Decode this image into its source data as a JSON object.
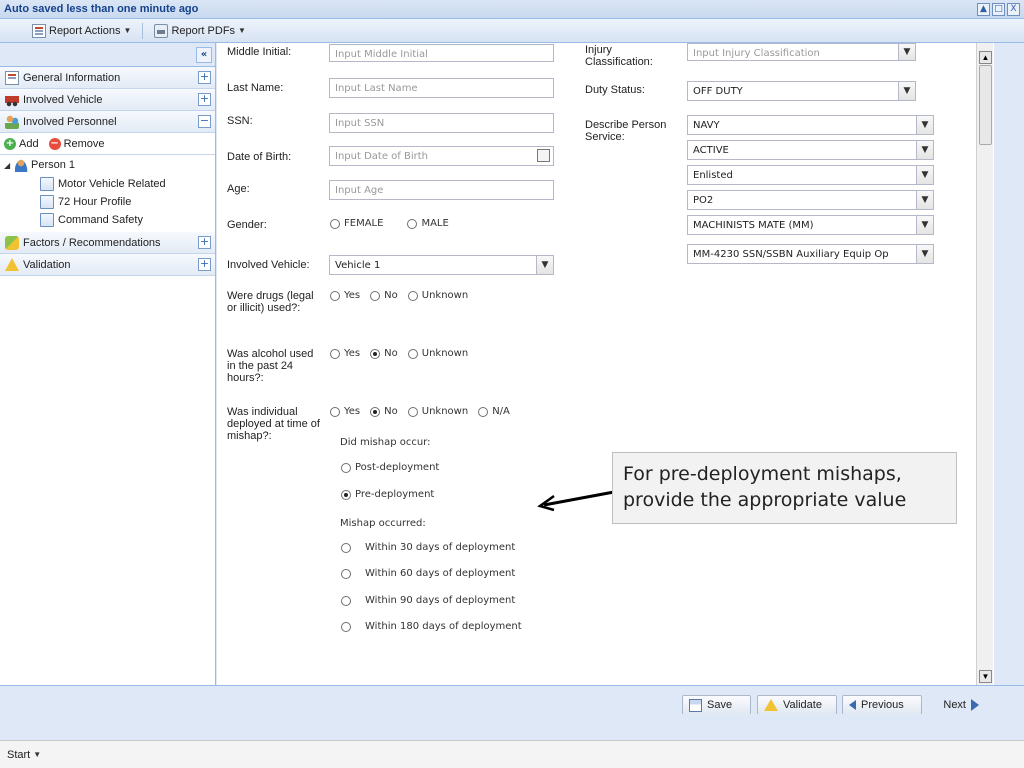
{
  "window": {
    "title": "Auto saved less than one minute ago",
    "controls": [
      "▲",
      "□",
      "X"
    ]
  },
  "toolbar": {
    "report_actions": "Report Actions",
    "report_pdfs": "Report PDFs"
  },
  "sidebar": {
    "collapse": "«",
    "items": [
      {
        "label": "General Information",
        "icon": "document-icon",
        "toggle": "+"
      },
      {
        "label": "Involved Vehicle",
        "icon": "car-icon",
        "toggle": "+"
      },
      {
        "label": "Involved Personnel",
        "icon": "people-icon",
        "toggle": "−"
      }
    ],
    "add_label": "Add",
    "remove_label": "Remove",
    "person_node": "Person 1",
    "person_children": [
      "Motor Vehicle Related",
      "72 Hour Profile",
      "Command Safety"
    ],
    "items_after": [
      {
        "label": "Factors / Recommendations",
        "icon": "puzzle-icon",
        "toggle": "+"
      },
      {
        "label": "Validation",
        "icon": "warning-icon",
        "toggle": "+"
      }
    ]
  },
  "form": {
    "middle_initial": {
      "label": "Middle Initial:",
      "placeholder": "Input Middle Initial"
    },
    "last_name": {
      "label": "Last Name:",
      "placeholder": "Input Last Name"
    },
    "ssn": {
      "label": "SSN:",
      "placeholder": "Input SSN"
    },
    "dob": {
      "label": "Date of Birth:",
      "placeholder": "Input Date of Birth"
    },
    "age": {
      "label": "Age:",
      "placeholder": "Input Age"
    },
    "gender": {
      "label": "Gender:",
      "options": [
        "FEMALE",
        "MALE"
      ]
    },
    "involved_vehicle": {
      "label": "Involved Vehicle:",
      "value": "Vehicle 1"
    },
    "drugs": {
      "label": "Were drugs (legal or illicit) used?:",
      "options": [
        "Yes",
        "No",
        "Unknown"
      ],
      "selected": null
    },
    "alcohol": {
      "label": "Was alcohol used in the past 24 hours?:",
      "options": [
        "Yes",
        "No",
        "Unknown"
      ],
      "selected": "No"
    },
    "deployed": {
      "label": "Was individual deployed at time of mishap?:",
      "options": [
        "Yes",
        "No",
        "Unknown",
        "N/A"
      ],
      "selected": "No"
    },
    "did_mishap_occur": {
      "label": "Did mishap occur:",
      "options": [
        "Post-deployment",
        "Pre-deployment"
      ],
      "selected": "Pre-deployment"
    },
    "mishap_occurred": {
      "label": "Mishap occurred:",
      "options": [
        "Within 30 days of deployment",
        "Within 60 days of deployment",
        "Within 90 days of deployment",
        "Within 180 days of deployment"
      ],
      "selected": null
    },
    "injury_classification": {
      "label": "Injury Classification:",
      "placeholder": "Input Injury Classification"
    },
    "duty_status": {
      "label": "Duty Status:",
      "value": "OFF DUTY"
    },
    "service": {
      "label": "Describe Person Service:",
      "values": [
        "NAVY",
        "ACTIVE",
        "Enlisted",
        "PO2",
        "MACHINISTS MATE (MM)",
        "MM-4230 SSN/SSBN Auxiliary Equip Op"
      ]
    }
  },
  "callout": {
    "text": "For pre-deployment mishaps, provide the appropriate value"
  },
  "buttons": {
    "save": "Save",
    "validate": "Validate",
    "previous": "Previous",
    "next": "Next"
  },
  "taskbar": {
    "start": "Start"
  }
}
